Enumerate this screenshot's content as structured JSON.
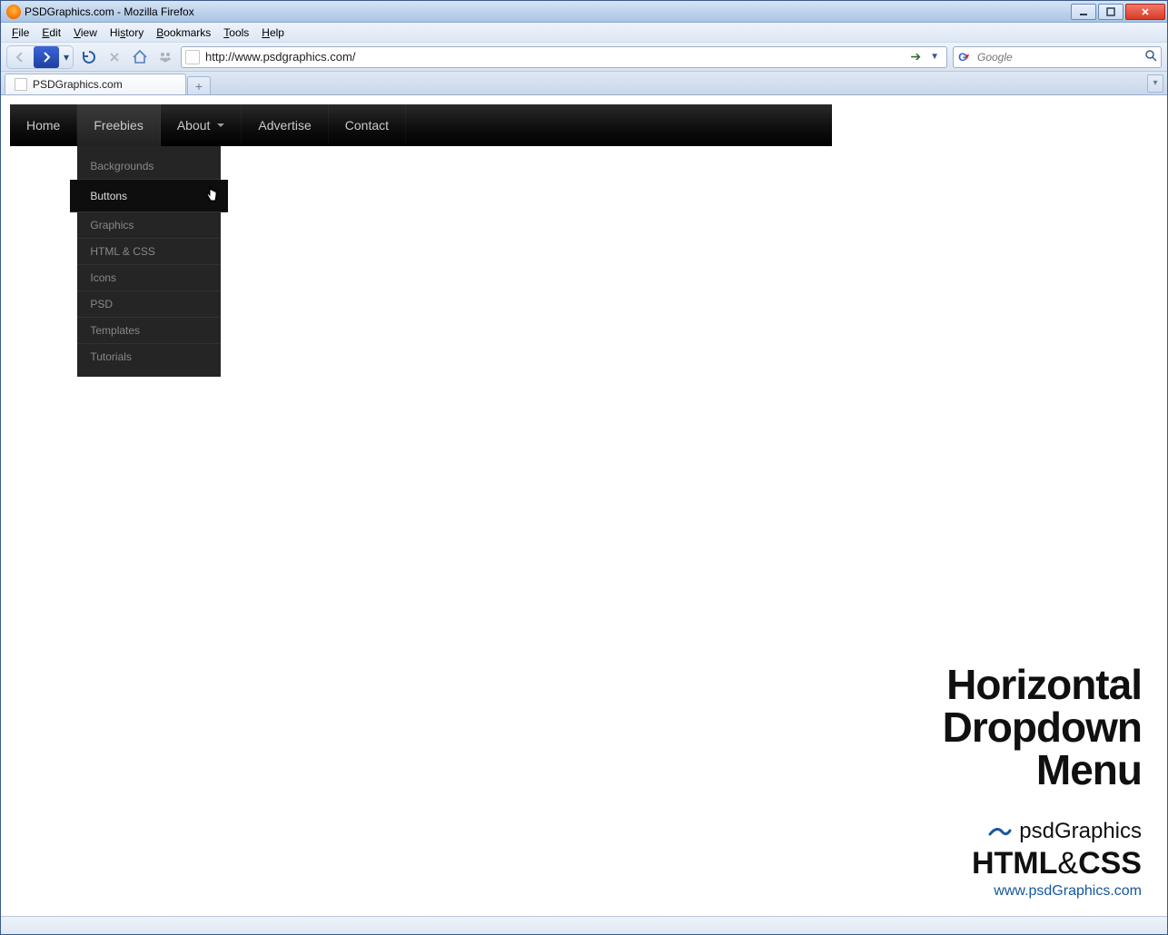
{
  "window": {
    "title": "PSDGraphics.com - Mozilla Firefox"
  },
  "menubar": {
    "file": "File",
    "edit": "Edit",
    "view": "View",
    "history": "History",
    "bookmarks": "Bookmarks",
    "tools": "Tools",
    "help": "Help"
  },
  "address": {
    "url": "http://www.psdgraphics.com/"
  },
  "search": {
    "placeholder": "Google"
  },
  "tab": {
    "label": "PSDGraphics.com"
  },
  "nav": {
    "items": [
      {
        "label": "Home"
      },
      {
        "label": "Freebies"
      },
      {
        "label": "About"
      },
      {
        "label": "Advertise"
      },
      {
        "label": "Contact"
      }
    ],
    "dropdown": {
      "items": [
        {
          "label": "Backgrounds"
        },
        {
          "label": "Buttons"
        },
        {
          "label": "Graphics"
        },
        {
          "label": "HTML & CSS"
        },
        {
          "label": "Icons"
        },
        {
          "label": "PSD"
        },
        {
          "label": "Templates"
        },
        {
          "label": "Tutorials"
        }
      ]
    }
  },
  "watermark": {
    "line1": "Horizontal",
    "line2": "Dropdown",
    "line3": "Menu",
    "brand": "psdGraphics",
    "htmlcss_html": "HTML",
    "htmlcss_amp": "&",
    "htmlcss_css": "CSS",
    "url": "www.psdGraphics.com"
  }
}
